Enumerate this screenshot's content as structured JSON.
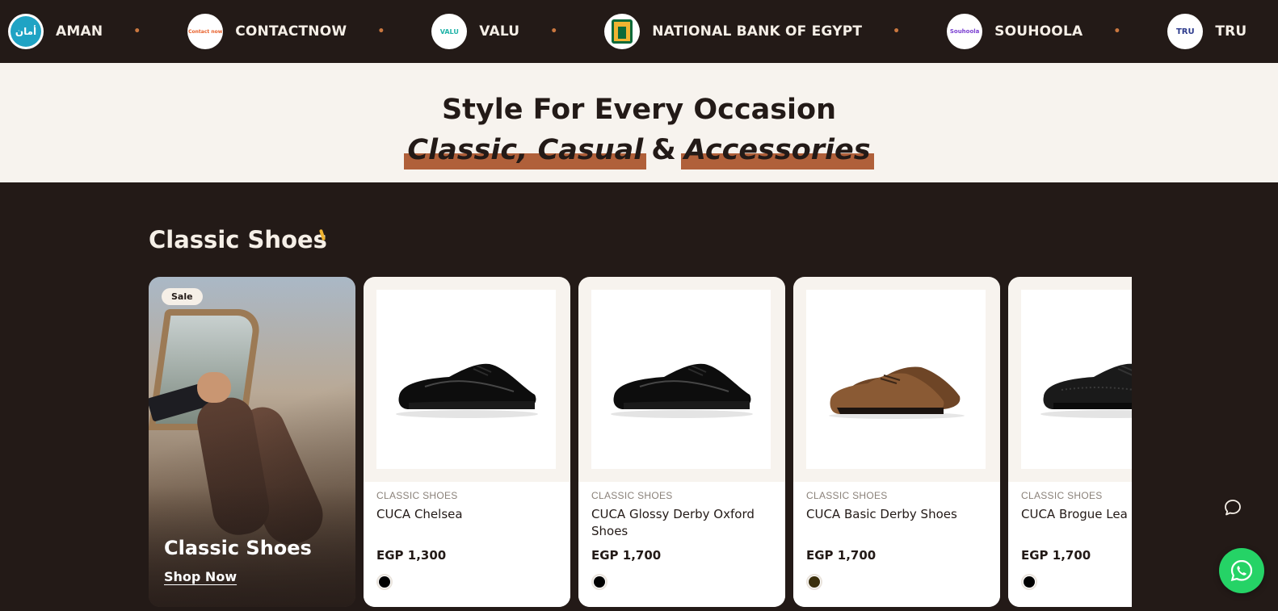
{
  "partners": [
    {
      "name": "AMAN",
      "logo_text": "أمان",
      "logo_icon": "aman-logo"
    },
    {
      "name": "CONTACTNOW",
      "logo_text": "Contact now",
      "logo_icon": "contactnow-logo"
    },
    {
      "name": "VALU",
      "logo_text": "VALU",
      "logo_icon": "valu-logo"
    },
    {
      "name": "NATIONAL BANK OF EGYPT",
      "logo_text": "",
      "logo_icon": "nbe-logo"
    },
    {
      "name": "SOUHOOLA",
      "logo_text": "Souhoola",
      "logo_icon": "souhoola-logo"
    },
    {
      "name": "TRU",
      "logo_text": "TRU",
      "logo_icon": "tru-logo"
    }
  ],
  "hero": {
    "title": "Style For Every Occasion",
    "sub_highlight_1": "Classic, Casual",
    "sub_amp": "&",
    "sub_highlight_2": "Accessories"
  },
  "section": {
    "title": "Classic Shoes"
  },
  "feature_card": {
    "badge": "Sale",
    "title": "Classic Shoes",
    "link": "Shop Now"
  },
  "products": [
    {
      "category": "CLASSIC SHOES",
      "name": "CUCA Chelsea",
      "price": "EGP 1,300",
      "swatch": "#000000",
      "shoe_color": "#0d0d0d"
    },
    {
      "category": "CLASSIC SHOES",
      "name": "CUCA Glossy Derby Oxford Shoes",
      "price": "EGP 1,700",
      "swatch": "#000000",
      "shoe_color": "#0d0d0d"
    },
    {
      "category": "CLASSIC SHOES",
      "name": "CUCA Basic Derby Shoes",
      "price": "EGP 1,700",
      "swatch": "#3b2f0c",
      "shoe_color": "#8a5a34"
    },
    {
      "category": "CLASSIC SHOES",
      "name": "CUCA Brogue Lea",
      "price": "EGP 1,700",
      "swatch": "#000000",
      "shoe_color": "#1a1a1a"
    }
  ],
  "colors": {
    "background": "#231a17",
    "cream": "#f7f3ee",
    "highlight": "#b0603a",
    "accent_dot": "#c9773f",
    "whatsapp": "#25d366"
  },
  "floating": {
    "chat_icon": "chat-bubble-icon",
    "whatsapp_icon": "whatsapp-icon"
  }
}
